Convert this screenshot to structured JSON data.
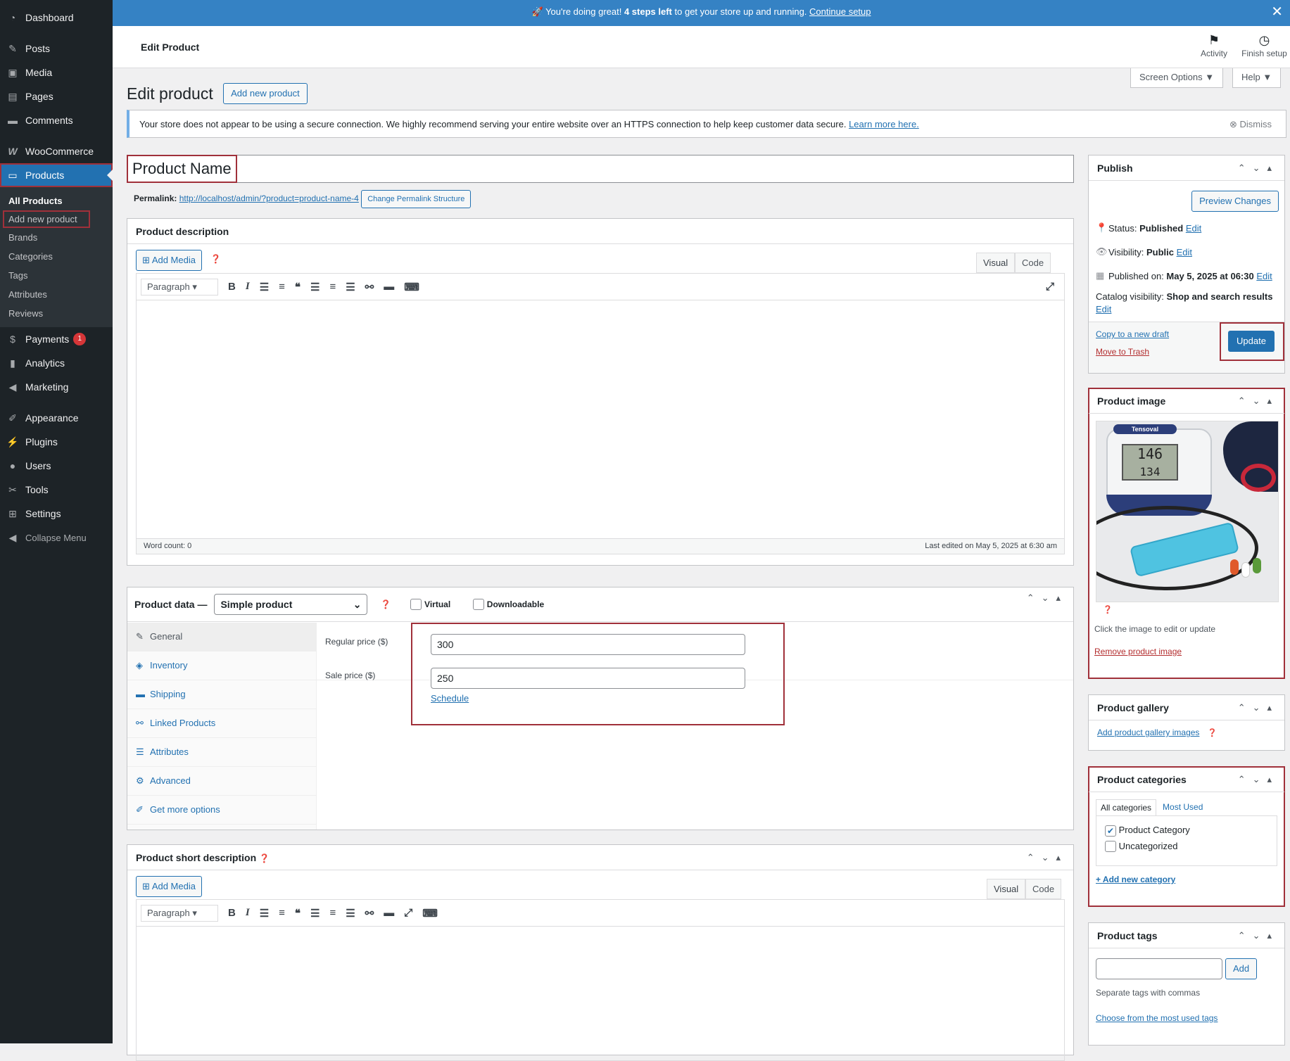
{
  "banner": {
    "emoji": "🚀",
    "pre": "You're doing great!",
    "bold": "4 steps left",
    "post": "to get your store up and running.",
    "link": "Continue setup"
  },
  "sidebar": {
    "items": [
      {
        "label": "Dashboard",
        "icon": "dashboard-icon"
      },
      {
        "label": "Posts",
        "icon": "pin-icon"
      },
      {
        "label": "Media",
        "icon": "media-icon"
      },
      {
        "label": "Pages",
        "icon": "pages-icon"
      },
      {
        "label": "Comments",
        "icon": "comments-icon"
      },
      {
        "label": "WooCommerce",
        "icon": "woocommerce-icon"
      },
      {
        "label": "Products",
        "icon": "products-icon"
      }
    ],
    "products_sub": [
      "All Products",
      "Add new product",
      "Brands",
      "Categories",
      "Tags",
      "Attributes",
      "Reviews"
    ],
    "items2": [
      {
        "label": "Payments",
        "badge": "1"
      },
      {
        "label": "Analytics"
      },
      {
        "label": "Marketing"
      },
      {
        "label": "Appearance"
      },
      {
        "label": "Plugins"
      },
      {
        "label": "Users"
      },
      {
        "label": "Tools"
      },
      {
        "label": "Settings"
      },
      {
        "label": "Collapse Menu"
      }
    ]
  },
  "header": {
    "title": "Edit Product",
    "activity": "Activity",
    "finish": "Finish setup",
    "screen_options": "Screen Options ▼",
    "help": "Help ▼"
  },
  "page": {
    "heading": "Edit product",
    "add_new": "Add new product"
  },
  "notice": {
    "text": "Your store does not appear to be using a secure connection. We highly recommend serving your entire website over an HTTPS connection to help keep customer data secure.",
    "link": "Learn more here.",
    "dismiss": "Dismiss"
  },
  "title_input": "Product Name",
  "permalink": {
    "label": "Permalink:",
    "url": "http://localhost/admin/?product=product-name-4",
    "button": "Change Permalink Structure"
  },
  "description": {
    "title": "Product description",
    "add_media": "Add Media",
    "tab_visual": "Visual",
    "tab_code": "Code",
    "format": "Paragraph",
    "word_count": "Word count: 0",
    "last_edited": "Last edited on May 5, 2025 at 6:30 am"
  },
  "product_data": {
    "title": "Product data —",
    "type": "Simple product",
    "virtual": "Virtual",
    "downloadable": "Downloadable",
    "tabs": [
      "General",
      "Inventory",
      "Shipping",
      "Linked Products",
      "Attributes",
      "Advanced",
      "Get more options"
    ],
    "regular_label": "Regular price ($)",
    "regular_value": "300",
    "sale_label": "Sale price ($)",
    "sale_value": "250",
    "schedule": "Schedule"
  },
  "short_desc": {
    "title": "Product short description",
    "add_media": "Add Media",
    "tab_visual": "Visual",
    "tab_code": "Code",
    "format": "Paragraph"
  },
  "publish": {
    "title": "Publish",
    "preview": "Preview Changes",
    "status_label": "Status:",
    "status": "Published",
    "visibility_label": "Visibility:",
    "visibility": "Public",
    "published_label": "Published on:",
    "published": "May 5, 2025 at 06:30",
    "catalog_label": "Catalog visibility:",
    "catalog": "Shop and search results",
    "edit": "Edit",
    "copy": "Copy to a new draft",
    "trash": "Move to Trash",
    "update": "Update"
  },
  "product_image": {
    "title": "Product image",
    "device_brand": "Tensoval",
    "reading1": "146",
    "reading2": "134",
    "hint": "Click the image to edit or update",
    "remove": "Remove product image"
  },
  "gallery": {
    "title": "Product gallery",
    "add": "Add product gallery images"
  },
  "categories": {
    "title": "Product categories",
    "tab_all": "All categories",
    "tab_used": "Most Used",
    "items": [
      {
        "label": "Product Category",
        "checked": true
      },
      {
        "label": "Uncategorized",
        "checked": false
      }
    ],
    "add": "+ Add new category"
  },
  "tags": {
    "title": "Product tags",
    "add": "Add",
    "hint": "Separate tags with commas",
    "choose": "Choose from the most used tags"
  }
}
